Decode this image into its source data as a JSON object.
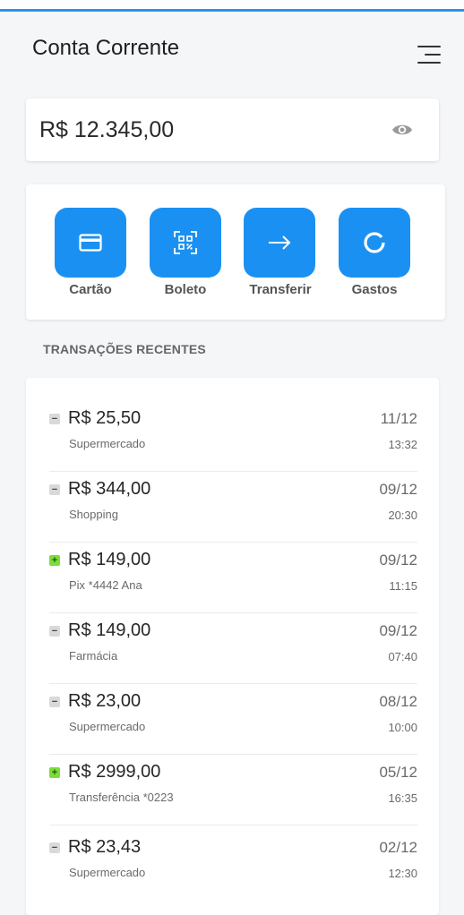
{
  "header": {
    "title": "Conta Corrente",
    "menu_icon": "hamburger-menu-icon"
  },
  "balance": {
    "value": "R$ 12.345,00",
    "visibility_icon": "eye-icon"
  },
  "actions": [
    {
      "label": "Cartão",
      "icon": "card-icon"
    },
    {
      "label": "Boleto",
      "icon": "qr-code-icon"
    },
    {
      "label": "Transferir",
      "icon": "arrow-right-icon"
    },
    {
      "label": "Gastos",
      "icon": "donut-chart-icon"
    }
  ],
  "transactions_title": "TRANSAÇÕES RECENTES",
  "transactions": [
    {
      "type": "out",
      "sign": "−",
      "amount": "R$ 25,50",
      "description": "Supermercado",
      "date": "11/12",
      "time": "13:32"
    },
    {
      "type": "out",
      "sign": "−",
      "amount": "R$ 344,00",
      "description": "Shopping",
      "date": "09/12",
      "time": "20:30"
    },
    {
      "type": "in",
      "sign": "+",
      "amount": "R$ 149,00",
      "description": "Pix *4442 Ana",
      "date": "09/12",
      "time": "11:15"
    },
    {
      "type": "out",
      "sign": "−",
      "amount": "R$ 149,00",
      "description": "Farmácia",
      "date": "09/12",
      "time": "07:40"
    },
    {
      "type": "out",
      "sign": "−",
      "amount": "R$ 23,00",
      "description": "Supermercado",
      "date": "08/12",
      "time": "10:00"
    },
    {
      "type": "in",
      "sign": "+",
      "amount": "R$ 2999,00",
      "description": "Transferência *0223",
      "date": "05/12",
      "time": "16:35"
    },
    {
      "type": "out",
      "sign": "−",
      "amount": "R$ 23,43",
      "description": "Supermercado",
      "date": "02/12",
      "time": "12:30"
    }
  ],
  "colors": {
    "accent": "#1a91f2",
    "top_bar": "#2196f3",
    "income": "#7ddc3a",
    "expense": "#d9d9d9"
  }
}
